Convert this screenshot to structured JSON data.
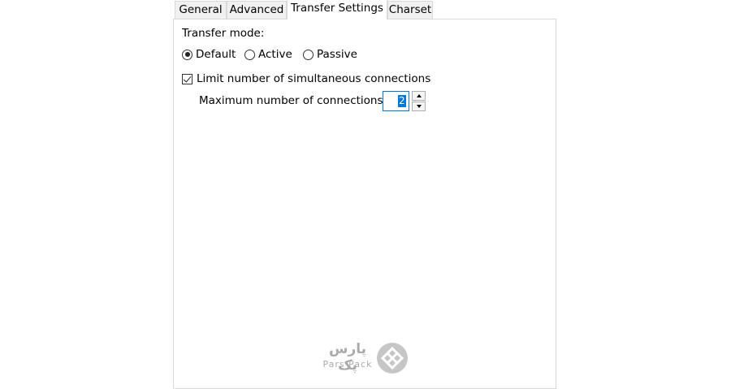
{
  "tabs": [
    {
      "label": "General"
    },
    {
      "label": "Advanced"
    },
    {
      "label": "Transfer Settings"
    },
    {
      "label": "Charset"
    }
  ],
  "active_tab": "Transfer Settings",
  "transfer": {
    "mode_label": "Transfer mode:",
    "modes": [
      {
        "label": "Default",
        "checked": true
      },
      {
        "label": "Active",
        "checked": false
      },
      {
        "label": "Passive",
        "checked": false
      }
    ],
    "limit_checkbox_label": "Limit number of simultaneous connections",
    "limit_checked": true,
    "max_connections_label": "Maximum number of connections:",
    "max_connections_value": "2"
  },
  "watermark": {
    "text_fa": "پارس پک",
    "text_en": "Pars Pack",
    "logo_icon": "diamond-logo-icon"
  },
  "colors": {
    "selection": "#0078d7",
    "border": "#d9d9d9",
    "tab_inactive_bg": "#f0f0f0"
  }
}
